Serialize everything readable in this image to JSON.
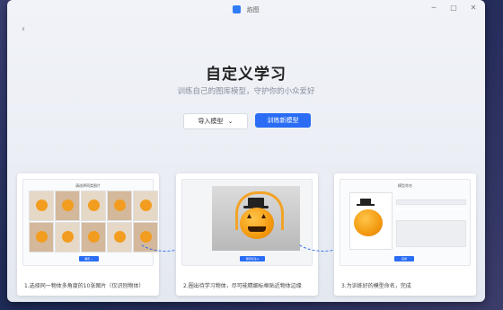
{
  "window": {
    "app_title": "焰图",
    "controls": [
      "─",
      "□",
      "✕"
    ]
  },
  "nav": {
    "back_icon": "‹"
  },
  "hero": {
    "title": "自定义学习",
    "subtitle": "训练自己的图库模型，守护你的小众爱好"
  },
  "actions": {
    "import_label": "导入模型",
    "import_chevron": "⌄",
    "train_label": "训练新模型"
  },
  "steps": [
    {
      "caption": "1.选择同一物体多角度的10张图片（仅识别物体）",
      "mini_title": "请选择同类图片",
      "mini_button": "确定 ⌄"
    },
    {
      "caption": "2.圈出待学习物体，尽可能精细标框贴近物体边缘",
      "mini_button": "保存标注 ▸"
    },
    {
      "caption": "3.为训练好的模型命名，完成",
      "mini_title": "模型命名",
      "mini_button": "完成"
    }
  ],
  "colors": {
    "accent": "#2a6df4",
    "pumpkin": "#f39a10",
    "background": "#eceff5"
  }
}
